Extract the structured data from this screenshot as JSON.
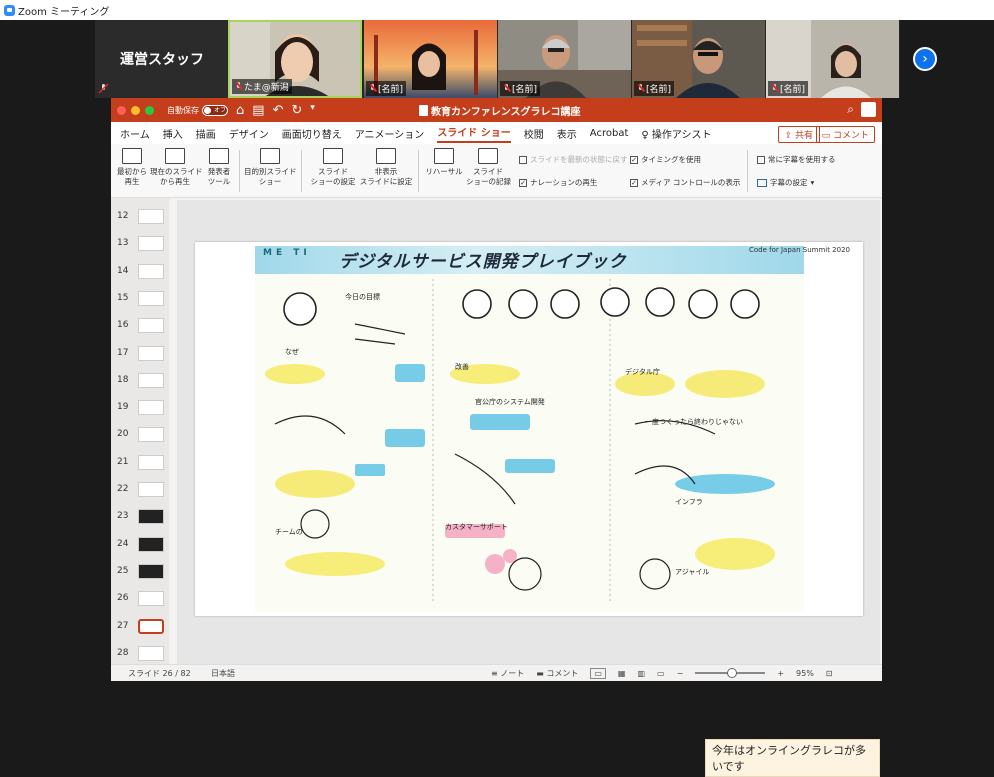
{
  "window": {
    "title": "Zoom ミーティング"
  },
  "gallery": {
    "staff_label": "運営スタッフ",
    "tiles": [
      {
        "name": "たま@新潟",
        "bg": "#bdb7a5"
      },
      {
        "name": "[名前]",
        "bg": "#f08a4a"
      },
      {
        "name": "[名前]",
        "bg": "#8c8a80"
      },
      {
        "name": "[名前]",
        "bg": "#6d6a62"
      },
      {
        "name": "[名前]",
        "bg": "#b8b3a8"
      }
    ],
    "next_icon": "chevron-right-icon"
  },
  "ppt": {
    "autosave_label": "自動保存",
    "autosave_state": "オフ",
    "doc_title": "教育カンファレンスグラレコ講座",
    "tabs": [
      "ホーム",
      "挿入",
      "描画",
      "デザイン",
      "画面切り替え",
      "アニメーション",
      "スライド ショー",
      "校閲",
      "表示",
      "Acrobat",
      "操作アシスト"
    ],
    "active_tab": "スライド ショー",
    "share": "共有",
    "comment": "コメント",
    "ribbon": {
      "from_start": "最初から\n再生",
      "from_current": "現在のスライド\nから再生",
      "presenter": "発表者\nツール",
      "custom": "目的別スライド\nショー",
      "setup": "スライド\nショーの設定",
      "hide": "非表示\nスライドに設定",
      "rehearse": "リハーサル",
      "record": "スライド\nショーの記録",
      "reset_slide": "スライドを最新の状態に戻す",
      "narration": "ナレーションの再生",
      "timing": "タイミングを使用",
      "media_controls": "メディア コントロールの表示",
      "always_subtitles": "常に字幕を使用する",
      "subtitle_settings": "字幕の設定"
    },
    "thumbnails": [
      {
        "num": "12"
      },
      {
        "num": "13"
      },
      {
        "num": "14"
      },
      {
        "num": "15"
      },
      {
        "num": "16"
      },
      {
        "num": "17"
      },
      {
        "num": "18"
      },
      {
        "num": "19"
      },
      {
        "num": "20"
      },
      {
        "num": "21"
      },
      {
        "num": "22"
      },
      {
        "num": "23"
      },
      {
        "num": "24"
      },
      {
        "num": "25"
      },
      {
        "num": "26"
      },
      {
        "num": "27"
      },
      {
        "num": "28"
      }
    ],
    "slide": {
      "title": "デジタルサービス開発プレイブック",
      "corner": "Code for Japan Summit 2020",
      "tag": "ME TI",
      "caption": "今年はオンライングラレコが多いです"
    },
    "status": {
      "slide_counter": "スライド 26 / 82",
      "language": "日本語",
      "notes": "ノート",
      "comments": "コメント",
      "zoom": "95%"
    }
  }
}
